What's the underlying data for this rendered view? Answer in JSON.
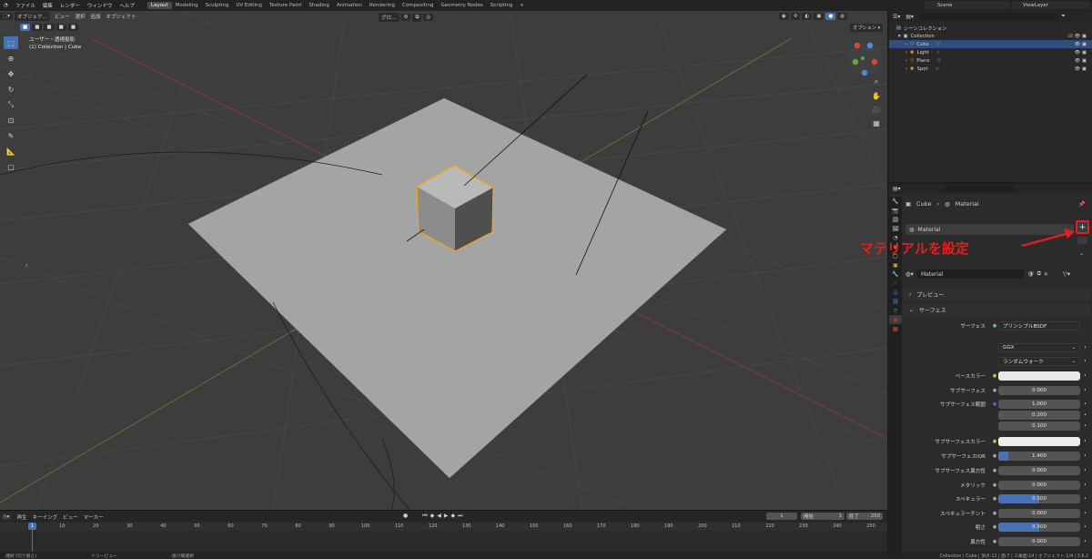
{
  "menubar": {
    "items": [
      "ファイル",
      "編集",
      "レンダー",
      "ウィンドウ",
      "ヘルプ"
    ],
    "workspaces": [
      "Layout",
      "Modeling",
      "Sculpting",
      "UV Editing",
      "Texture Paint",
      "Shading",
      "Animation",
      "Rendering",
      "Compositing",
      "Geometry Nodes",
      "Scripting"
    ],
    "active_workspace": "Layout",
    "scene": "Scene",
    "view_layer": "ViewLayer"
  },
  "viewport": {
    "mode": "オブジェク…",
    "menus": [
      "ビュー",
      "選択",
      "追加",
      "オブジェクト"
    ],
    "transform_orientation": "グロ…",
    "options": "オプション",
    "overlay_title": "ユーザー・透視投影",
    "overlay_subtitle": "(1) Collection | Cube"
  },
  "outliner": {
    "root": "シーンコレクション",
    "collection": "Collection",
    "objects": [
      {
        "name": "Cube",
        "selected": true
      },
      {
        "name": "Light",
        "selected": false
      },
      {
        "name": "Plane",
        "selected": false
      },
      {
        "name": "Spot",
        "selected": false
      }
    ]
  },
  "properties": {
    "breadcrumb_object": "Cube",
    "breadcrumb_material": "Material",
    "slot_name": "Material",
    "material_name": "Material",
    "annotation": "マテリアルを設定",
    "preview_panel": "プレビュー",
    "surface_panel": "サーフェス",
    "surface_label": "サーフェス",
    "surface_shader": "プリンシプルBSDF",
    "distribution": "GGX",
    "subsurface_method": "ランダムウォーク",
    "params": [
      {
        "label": "ベースカラー",
        "value": "",
        "type": "color",
        "color": "#e8e8e8"
      },
      {
        "label": "サブサーフェス",
        "value": "0.000",
        "type": "num",
        "fill": 0
      },
      {
        "label": "サブサーフェス範囲",
        "value": "1.000",
        "type": "num",
        "fill": 0
      },
      {
        "label": "",
        "value": "0.200",
        "type": "num",
        "fill": 0
      },
      {
        "label": "",
        "value": "0.100",
        "type": "num",
        "fill": 0
      },
      {
        "label": "サブサーフェスカラー",
        "value": "",
        "type": "color",
        "color": "#eeeeee"
      },
      {
        "label": "サブサーフェスIOR",
        "value": "1.400",
        "type": "num",
        "fill": 0.12
      },
      {
        "label": "サブサーフェス異方性",
        "value": "0.000",
        "type": "num",
        "fill": 0
      },
      {
        "label": "メタリック",
        "value": "0.000",
        "type": "num",
        "fill": 0
      },
      {
        "label": "スペキュラー",
        "value": "0.500",
        "type": "num",
        "fill": 0.5
      },
      {
        "label": "スペキュラーチント",
        "value": "0.000",
        "type": "num",
        "fill": 0
      },
      {
        "label": "粗さ",
        "value": "0.500",
        "type": "num",
        "fill": 0.5
      },
      {
        "label": "異方性",
        "value": "0.000",
        "type": "num",
        "fill": 0
      }
    ]
  },
  "timeline": {
    "menus": [
      "再生",
      "キーイング",
      "ビュー",
      "マーカー"
    ],
    "current_frame": "1",
    "start_label": "開始",
    "start": "1",
    "end_label": "終了",
    "end": "250",
    "ticks": [
      "1",
      "10",
      "20",
      "30",
      "40",
      "50",
      "60",
      "70",
      "80",
      "90",
      "100",
      "110",
      "120",
      "130",
      "140",
      "150",
      "160",
      "170",
      "180",
      "190",
      "200",
      "210",
      "220",
      "230",
      "240",
      "250"
    ]
  },
  "statusbar": {
    "left1": "選択 (切り替え)",
    "left2": "ドリーピュー",
    "left3": "投げ縄選択",
    "right": "Collection | Cube | 頂点:12 | 面:7 | 三角面:14 | オブジェクト:1/4 | 3.6.2"
  },
  "colors": {
    "accent": "#4772b3",
    "annotation": "#e02020",
    "selection_outline": "#ffa500"
  }
}
